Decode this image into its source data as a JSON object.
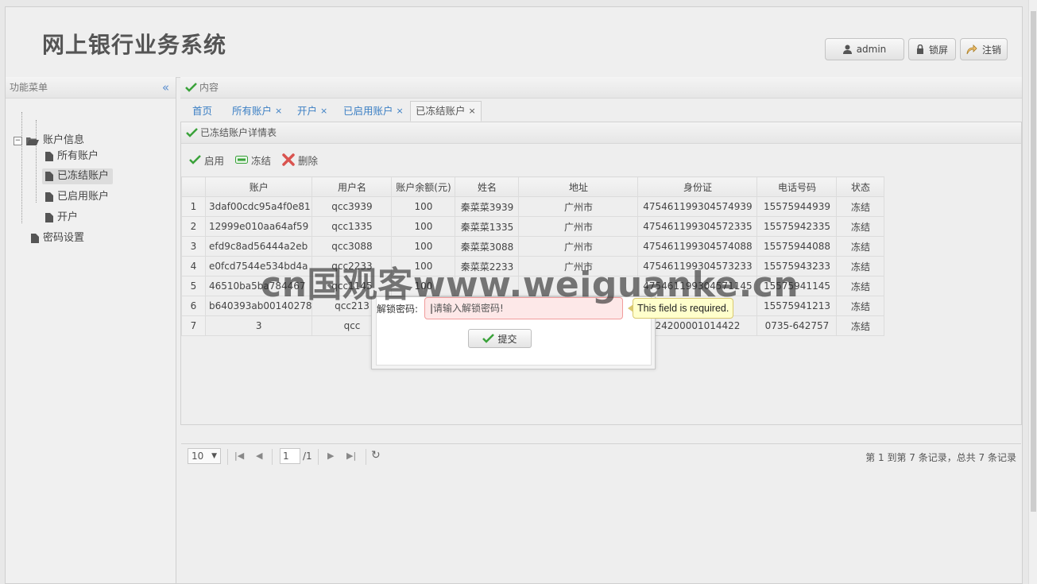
{
  "header": {
    "title": "网上银行业务系统",
    "user_label": "admin",
    "lock_label": "锁屏",
    "logout_label": "注销"
  },
  "sidebar": {
    "title": "功能菜单",
    "group_label": "账户信息",
    "items": [
      {
        "label": "所有账户"
      },
      {
        "label": "已冻结账户",
        "selected": true
      },
      {
        "label": "已启用账户"
      },
      {
        "label": "开户"
      }
    ],
    "password_label": "密码设置"
  },
  "content": {
    "title": "内容",
    "tabs": [
      {
        "label": "首页",
        "closable": false
      },
      {
        "label": "所有账户",
        "closable": true
      },
      {
        "label": "开户",
        "closable": true
      },
      {
        "label": "已启用账户",
        "closable": true
      },
      {
        "label": "已冻结账户",
        "closable": true,
        "active": true
      }
    ],
    "close_glyph": "×"
  },
  "grid": {
    "title": "已冻结账户详情表",
    "toolbar": {
      "enable": "启用",
      "freeze": "冻结",
      "delete": "删除"
    },
    "columns": [
      "账户",
      "用户名",
      "账户余额(元)",
      "姓名",
      "地址",
      "身份证",
      "电话号码",
      "状态"
    ],
    "rows": [
      {
        "n": "1",
        "account": "3daf00cdc95a4f0e81",
        "username": "qcc3939",
        "balance": "100",
        "name": "秦菜菜3939",
        "address": "广州市",
        "id": "475461199304574939",
        "phone": "15575944939",
        "status": "冻结"
      },
      {
        "n": "2",
        "account": "12999e010aa64af59",
        "username": "qcc1335",
        "balance": "100",
        "name": "秦菜菜1335",
        "address": "广州市",
        "id": "475461199304572335",
        "phone": "15575942335",
        "status": "冻结"
      },
      {
        "n": "3",
        "account": "efd9c8ad56444a2eb",
        "username": "qcc3088",
        "balance": "100",
        "name": "秦菜菜3088",
        "address": "广州市",
        "id": "475461199304574088",
        "phone": "15575944088",
        "status": "冻结"
      },
      {
        "n": "4",
        "account": "e0fcd7544e534bd4a",
        "username": "qcc2233",
        "balance": "100",
        "name": "秦菜菜2233",
        "address": "广州市",
        "id": "475461199304573233",
        "phone": "15575943233",
        "status": "冻结"
      },
      {
        "n": "5",
        "account": "46510ba5ba784467",
        "username": "qcc1145",
        "balance": "100",
        "name": "",
        "address": "",
        "id": "475461199304571145",
        "phone": "15575941145",
        "status": "冻结"
      },
      {
        "n": "6",
        "account": "b640393ab00140278",
        "username": "qcc213",
        "balance": "",
        "name": "",
        "address": "",
        "id": "",
        "phone": "15575941213",
        "status": "冻结"
      },
      {
        "n": "7",
        "account": "3",
        "username": "qcc",
        "balance": "",
        "name": "",
        "address": "",
        "id": "24200001014422",
        "phone": "0735-642757",
        "status": "冻结"
      }
    ],
    "pager": {
      "page_size": "10",
      "page": "1",
      "total_pages": "/1",
      "summary": "第 1 到第 7 条记录，总共 7 条记录"
    }
  },
  "dialog": {
    "label": "解锁密码:",
    "placeholder": "请输入解锁密码!",
    "submit": "提交",
    "error": "This field is required."
  },
  "watermark": "cn国观客www.weiguanke.cn",
  "colors": {
    "accent": "#3b7fc4",
    "check": "#3aa23a",
    "delete": "#d9534f"
  }
}
